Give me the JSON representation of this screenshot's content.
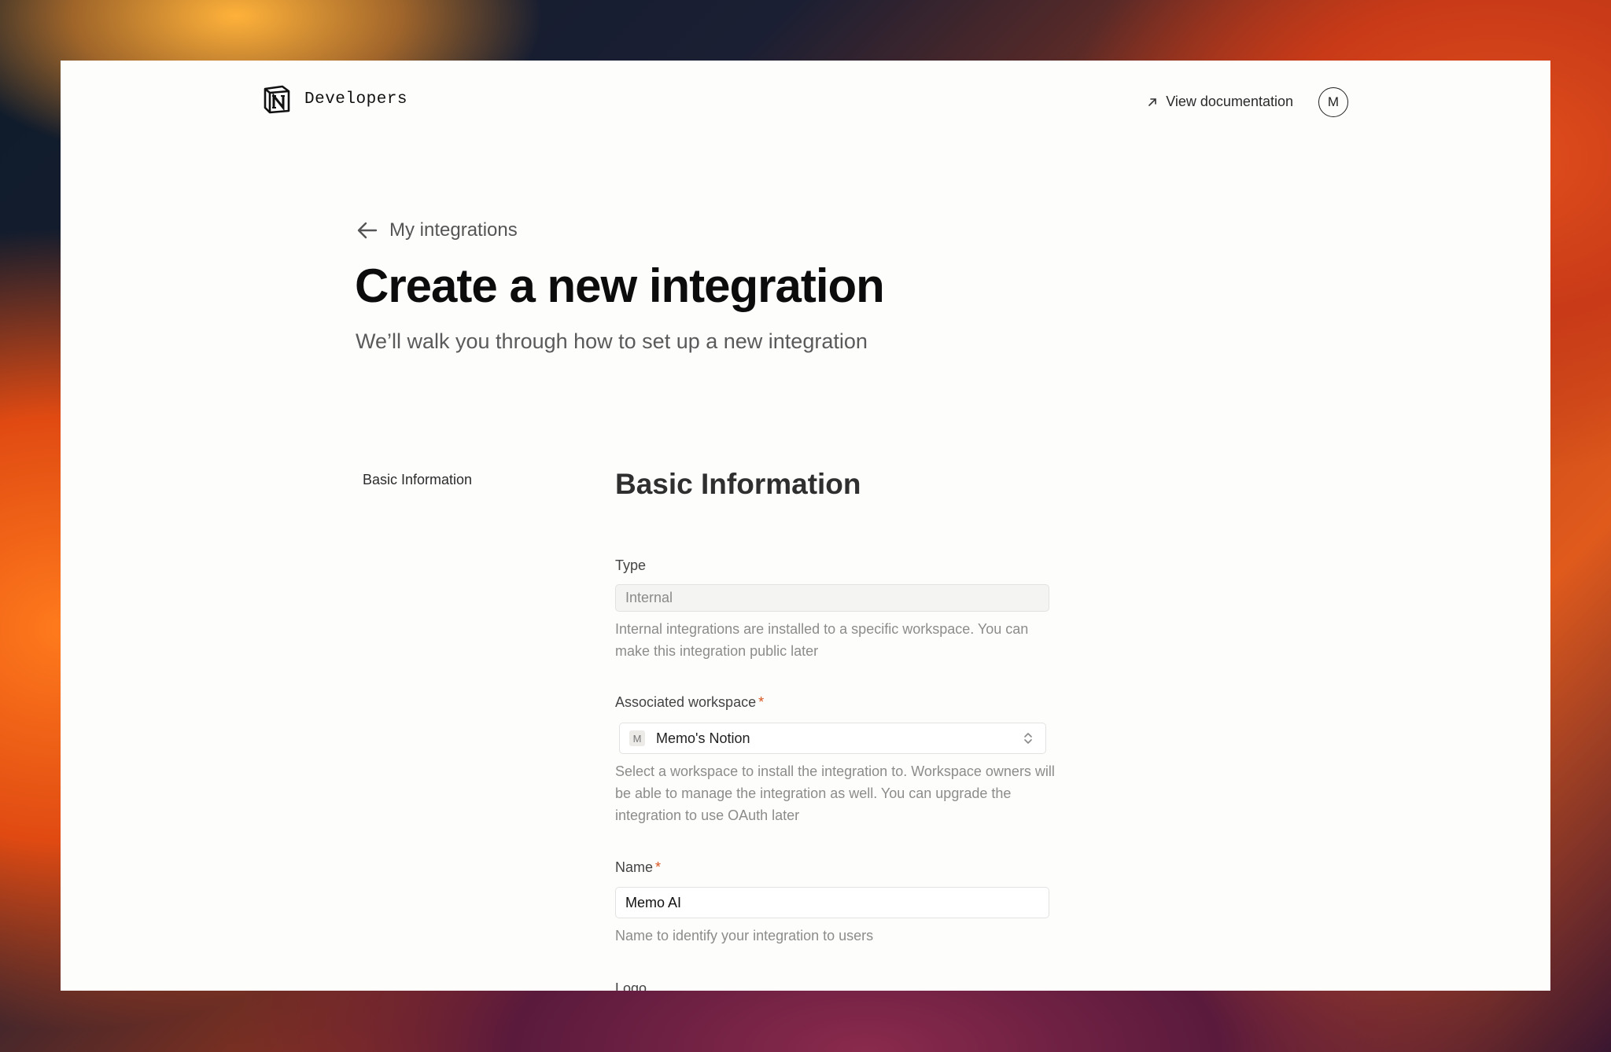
{
  "header": {
    "brand_name": "Developers",
    "doc_link_label": "View documentation",
    "avatar_initial": "M"
  },
  "nav": {
    "back_label": "My integrations"
  },
  "page": {
    "title": "Create a new integration",
    "subtitle": "We’ll walk you through how to set up a new integration"
  },
  "sidenav": {
    "items": [
      "Basic Information"
    ]
  },
  "form": {
    "section_title": "Basic Information",
    "type": {
      "label": "Type",
      "value": "Internal",
      "help": "Internal integrations are installed to a specific workspace. You can make this integration public later"
    },
    "workspace": {
      "label": "Associated workspace",
      "required_mark": "*",
      "badge": "M",
      "value": "Memo's Notion",
      "help": "Select a workspace to install the integration to. Workspace owners will be able to manage the integration as well. You can upgrade the integration to use OAuth later"
    },
    "name": {
      "label": "Name",
      "required_mark": "*",
      "value": "Memo AI",
      "help": "Name to identify your integration to users"
    },
    "logo": {
      "label": "Logo"
    }
  },
  "colors": {
    "required": "#d9541e",
    "page_bg": "#fdfdfc"
  }
}
